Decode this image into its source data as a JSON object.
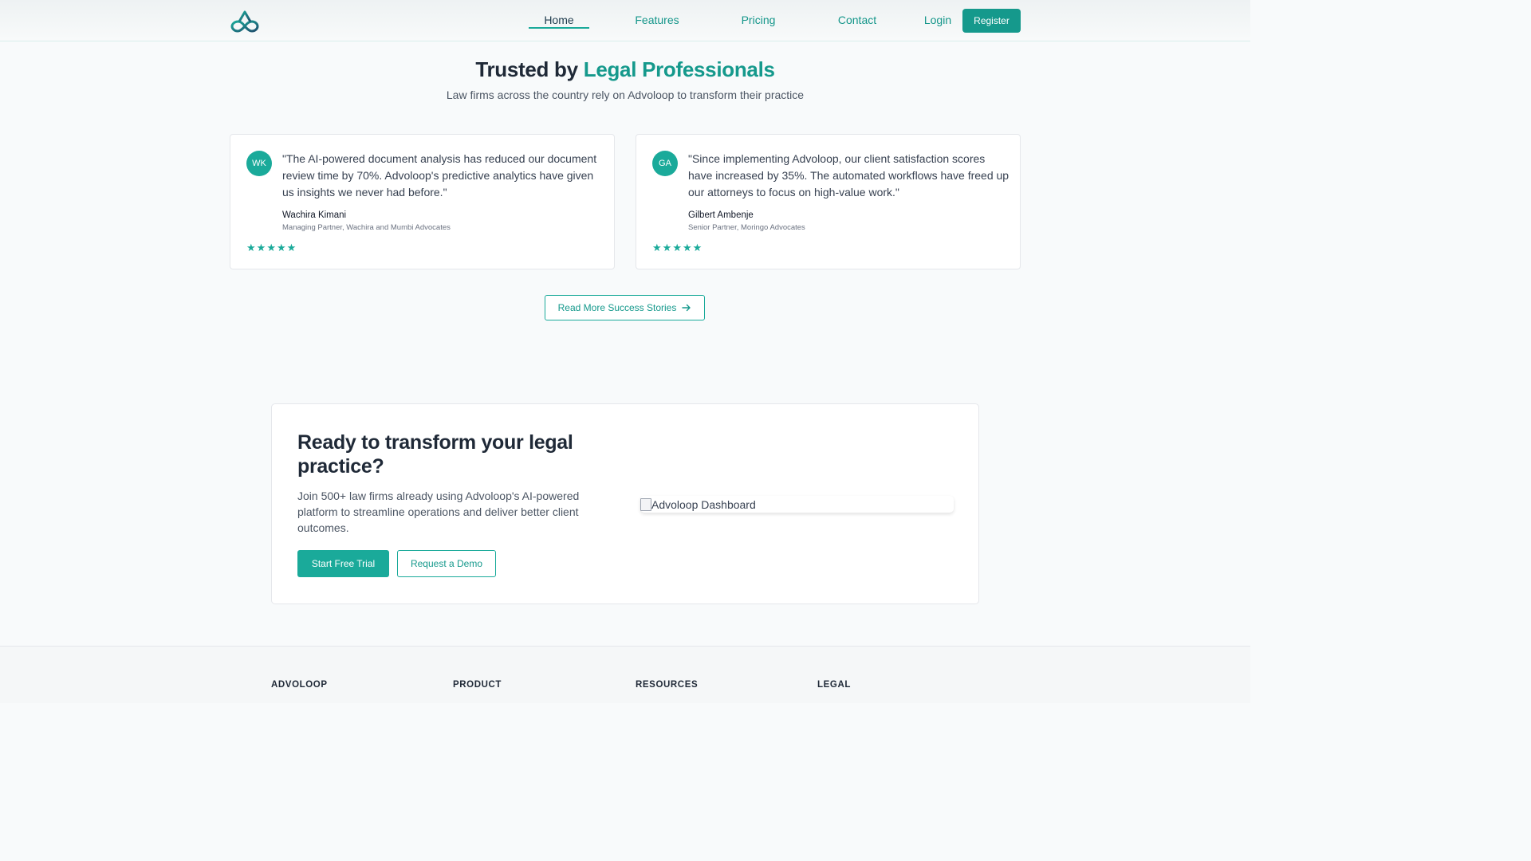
{
  "nav": {
    "links": [
      {
        "label": "Home",
        "active": true
      },
      {
        "label": "Features"
      },
      {
        "label": "Pricing"
      },
      {
        "label": "Contact"
      }
    ],
    "login_label": "Login",
    "register_label": "Register",
    "logo_icon": "infinity-loop-icon"
  },
  "section": {
    "title_prefix": "Trusted by",
    "title_accent": "Legal Professionals",
    "subtitle": "Law firms across the country rely on Advoloop to transform their practice"
  },
  "testimonials": [
    {
      "initials": "WK",
      "quote": "\"The AI-powered document analysis has reduced our document review time by 70%. Advoloop's predictive analytics have given us insights we never had before.\"",
      "name": "Wachira Kimani",
      "role": "Managing Partner, Wachira and Mumbi Advocates",
      "rating": 5
    },
    {
      "initials": "GA",
      "quote": "\"Since implementing Advoloop, our client satisfaction scores have increased by 35%. The automated workflows have freed up our attorneys to focus on high-value work.\"",
      "name": "Gilbert Ambenje",
      "role": "Senior Partner, Moringo Advocates",
      "rating": 5
    }
  ],
  "more_stories_label": "Read More Success Stories",
  "cta": {
    "title": "Ready to transform your legal practice?",
    "text": "Join 500+ law firms already using Advoloop's AI-powered platform to streamline operations and deliver better client outcomes.",
    "trial_label": "Start Free Trial",
    "demo_label": "Request a Demo",
    "image_alt": "Advoloop Dashboard"
  },
  "footer": {
    "columns": [
      "ADVOLOOP",
      "PRODUCT",
      "RESOURCES",
      "LEGAL"
    ]
  },
  "colors": {
    "accent": "#1aaa9a",
    "accent_dark": "#15998c",
    "text_dark": "#1f2937"
  }
}
